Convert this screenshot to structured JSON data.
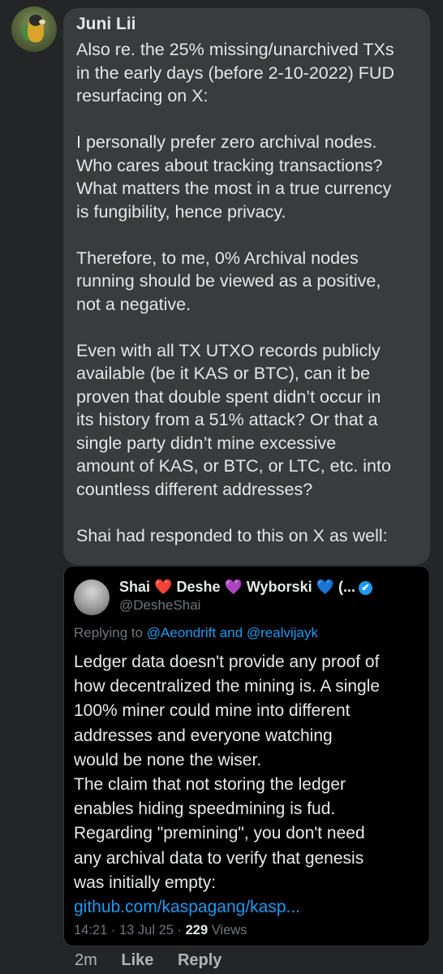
{
  "comment": {
    "author": "Juni Lii",
    "paragraphs": [
      [
        "Also re. the 25% missing/unarchived TXs",
        "in the early days (before 2-10-2022) FUD",
        "resurfacing on X:"
      ],
      [
        "I personally prefer zero archival nodes.",
        "Who cares about tracking transactions?",
        "What matters the most in a true currency",
        "is fungibility, hence privacy."
      ],
      [
        "Therefore, to me, 0% Archival nodes",
        "running should be viewed as a positive,",
        "not a negative."
      ],
      [
        "Even with all TX UTXO records publicly",
        "available (be it KAS or BTC), can it be",
        "proven that double spent didn’t occur in",
        "its history from a 51% attack? Or that a",
        "single party didn’t mine excessive",
        "amount of KAS, or BTC, or LTC, etc. into",
        "countless different addresses?"
      ],
      [
        "Shai had responded to this on X as well:"
      ]
    ]
  },
  "tweet": {
    "name_part1": "Shai ",
    "heart1": "❤️",
    "name_part2": " Deshe ",
    "heart2": "💜",
    "name_part3": " Wyborski ",
    "heart3": "💙",
    "name_part4": " (...",
    "verified_glyph": "✔",
    "handle": "@DesheShai",
    "replying_prefix": "Replying to ",
    "replying_users": "@Aeondrift and @realvijayk",
    "body_lines": [
      "Ledger data doesn't provide any proof of",
      "how decentralized the mining is. A single",
      "100% miner could mine into different",
      "addresses and everyone watching",
      "would be none the wiser.",
      "The claim that not storing the ledger",
      "enables hiding speedmining is fud.",
      "Regarding \"premining\", you don't need",
      "any archival data to verify that genesis",
      "was initially empty:"
    ],
    "link": "github.com/kaspagang/kasp...",
    "time": "14:21 · 13 Jul 25 · ",
    "views_count": "229",
    "views_label": " Views"
  },
  "actions": {
    "time_ago": "2m",
    "like_label": "Like",
    "reply_label": "Reply"
  },
  "colors": {
    "background": "#242526",
    "bubble": "#3a3b3c",
    "tweet_background": "#000000",
    "link_blue": "#1d9bf0",
    "muted": "#71767b"
  }
}
